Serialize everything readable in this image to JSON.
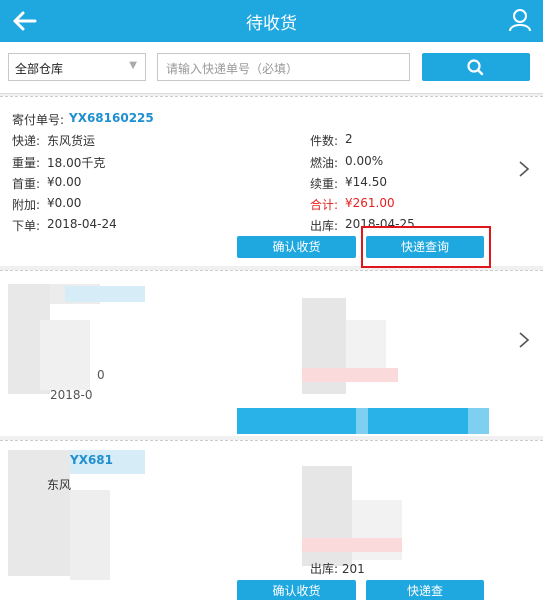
{
  "header": {
    "title": "待收货"
  },
  "toolbar": {
    "warehouse_select": "全部仓库",
    "search_placeholder": "请输入快递单号（必填）"
  },
  "order": {
    "number_label": "寄付单号:",
    "number": "YX68160225",
    "left_fields": [
      {
        "label": "快递:",
        "value": "东风货运"
      },
      {
        "label": "重量:",
        "value": "18.00千克"
      },
      {
        "label": "首重:",
        "value": "¥0.00"
      },
      {
        "label": "附加:",
        "value": "¥0.00"
      },
      {
        "label": "下单:",
        "value": "2018-04-24"
      }
    ],
    "right_fields": [
      {
        "label": "件数:",
        "value": "2"
      },
      {
        "label": "燃油:",
        "value": "0.00%"
      },
      {
        "label": "续重:",
        "value": "¥14.50"
      },
      {
        "label": "合计:",
        "value": "¥261.00"
      },
      {
        "label": "出库:",
        "value": "2018-04-25"
      }
    ],
    "confirm_button": "确认收货",
    "track_button": "快递查询"
  },
  "blurred_card_1": {
    "partial_date": "2018-0",
    "partial_value": "0"
  },
  "blurred_card_2": {
    "partial_number": "YX681",
    "partial_courier": "东风",
    "partial_outbound": "出库: 201",
    "confirm_button": "确认收货",
    "track_button": "快递查"
  },
  "colors": {
    "accent": "#1fa8e0",
    "highlight": "#e0161b",
    "total": "#e61e1e"
  }
}
